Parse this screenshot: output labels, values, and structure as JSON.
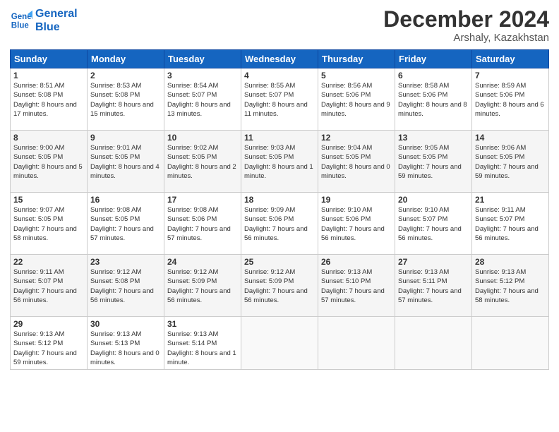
{
  "header": {
    "logo_line1": "General",
    "logo_line2": "Blue",
    "month_title": "December 2024",
    "location": "Arshaly, Kazakhstan"
  },
  "days_of_week": [
    "Sunday",
    "Monday",
    "Tuesday",
    "Wednesday",
    "Thursday",
    "Friday",
    "Saturday"
  ],
  "weeks": [
    [
      {
        "num": "1",
        "sunrise": "8:51 AM",
        "sunset": "5:08 PM",
        "daylight": "8 hours and 17 minutes."
      },
      {
        "num": "2",
        "sunrise": "8:53 AM",
        "sunset": "5:08 PM",
        "daylight": "8 hours and 15 minutes."
      },
      {
        "num": "3",
        "sunrise": "8:54 AM",
        "sunset": "5:07 PM",
        "daylight": "8 hours and 13 minutes."
      },
      {
        "num": "4",
        "sunrise": "8:55 AM",
        "sunset": "5:07 PM",
        "daylight": "8 hours and 11 minutes."
      },
      {
        "num": "5",
        "sunrise": "8:56 AM",
        "sunset": "5:06 PM",
        "daylight": "8 hours and 9 minutes."
      },
      {
        "num": "6",
        "sunrise": "8:58 AM",
        "sunset": "5:06 PM",
        "daylight": "8 hours and 8 minutes."
      },
      {
        "num": "7",
        "sunrise": "8:59 AM",
        "sunset": "5:06 PM",
        "daylight": "8 hours and 6 minutes."
      }
    ],
    [
      {
        "num": "8",
        "sunrise": "9:00 AM",
        "sunset": "5:05 PM",
        "daylight": "8 hours and 5 minutes."
      },
      {
        "num": "9",
        "sunrise": "9:01 AM",
        "sunset": "5:05 PM",
        "daylight": "8 hours and 4 minutes."
      },
      {
        "num": "10",
        "sunrise": "9:02 AM",
        "sunset": "5:05 PM",
        "daylight": "8 hours and 2 minutes."
      },
      {
        "num": "11",
        "sunrise": "9:03 AM",
        "sunset": "5:05 PM",
        "daylight": "8 hours and 1 minute."
      },
      {
        "num": "12",
        "sunrise": "9:04 AM",
        "sunset": "5:05 PM",
        "daylight": "8 hours and 0 minutes."
      },
      {
        "num": "13",
        "sunrise": "9:05 AM",
        "sunset": "5:05 PM",
        "daylight": "7 hours and 59 minutes."
      },
      {
        "num": "14",
        "sunrise": "9:06 AM",
        "sunset": "5:05 PM",
        "daylight": "7 hours and 59 minutes."
      }
    ],
    [
      {
        "num": "15",
        "sunrise": "9:07 AM",
        "sunset": "5:05 PM",
        "daylight": "7 hours and 58 minutes."
      },
      {
        "num": "16",
        "sunrise": "9:08 AM",
        "sunset": "5:05 PM",
        "daylight": "7 hours and 57 minutes."
      },
      {
        "num": "17",
        "sunrise": "9:08 AM",
        "sunset": "5:06 PM",
        "daylight": "7 hours and 57 minutes."
      },
      {
        "num": "18",
        "sunrise": "9:09 AM",
        "sunset": "5:06 PM",
        "daylight": "7 hours and 56 minutes."
      },
      {
        "num": "19",
        "sunrise": "9:10 AM",
        "sunset": "5:06 PM",
        "daylight": "7 hours and 56 minutes."
      },
      {
        "num": "20",
        "sunrise": "9:10 AM",
        "sunset": "5:07 PM",
        "daylight": "7 hours and 56 minutes."
      },
      {
        "num": "21",
        "sunrise": "9:11 AM",
        "sunset": "5:07 PM",
        "daylight": "7 hours and 56 minutes."
      }
    ],
    [
      {
        "num": "22",
        "sunrise": "9:11 AM",
        "sunset": "5:07 PM",
        "daylight": "7 hours and 56 minutes."
      },
      {
        "num": "23",
        "sunrise": "9:12 AM",
        "sunset": "5:08 PM",
        "daylight": "7 hours and 56 minutes."
      },
      {
        "num": "24",
        "sunrise": "9:12 AM",
        "sunset": "5:09 PM",
        "daylight": "7 hours and 56 minutes."
      },
      {
        "num": "25",
        "sunrise": "9:12 AM",
        "sunset": "5:09 PM",
        "daylight": "7 hours and 56 minutes."
      },
      {
        "num": "26",
        "sunrise": "9:13 AM",
        "sunset": "5:10 PM",
        "daylight": "7 hours and 57 minutes."
      },
      {
        "num": "27",
        "sunrise": "9:13 AM",
        "sunset": "5:11 PM",
        "daylight": "7 hours and 57 minutes."
      },
      {
        "num": "28",
        "sunrise": "9:13 AM",
        "sunset": "5:12 PM",
        "daylight": "7 hours and 58 minutes."
      }
    ],
    [
      {
        "num": "29",
        "sunrise": "9:13 AM",
        "sunset": "5:12 PM",
        "daylight": "7 hours and 59 minutes."
      },
      {
        "num": "30",
        "sunrise": "9:13 AM",
        "sunset": "5:13 PM",
        "daylight": "8 hours and 0 minutes."
      },
      {
        "num": "31",
        "sunrise": "9:13 AM",
        "sunset": "5:14 PM",
        "daylight": "8 hours and 1 minute."
      },
      null,
      null,
      null,
      null
    ]
  ]
}
